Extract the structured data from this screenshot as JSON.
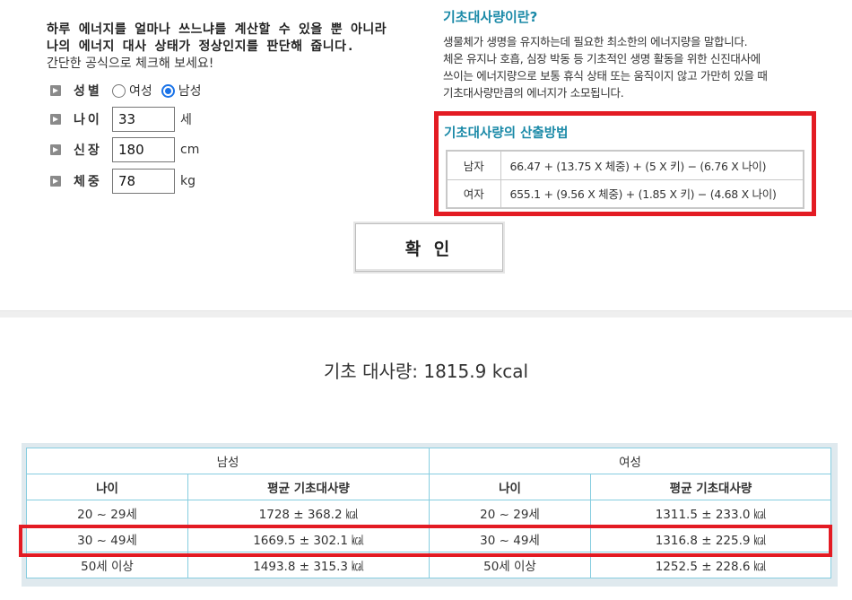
{
  "intro": {
    "line1": "하루 에너지를 얼마나 쓰느냐를 계산할 수 있을 뿐 아니라",
    "line2": "나의 에너지 대사 상태가 정상인지를 판단해 줍니다.",
    "line3": "간단한 공식으로 체크해 보세요!"
  },
  "form": {
    "gender_label": "성별",
    "female": "여성",
    "male": "남성",
    "selected": "남성",
    "age_label": "나이",
    "age_value": "33",
    "age_unit": "세",
    "height_label": "신장",
    "height_value": "180",
    "height_unit": "cm",
    "weight_label": "체중",
    "weight_value": "78",
    "weight_unit": "kg"
  },
  "info": {
    "title": "기초대사량이란?",
    "lines": [
      "생물체가 생명을 유지하는데 필요한 최소한의 에너지량을 말합니다.",
      "체온 유지나 호흡, 심장 박동 등 기초적인 생명 활동을 위한 신진대사에",
      "쓰이는 에너지량으로 보통 휴식 상태 또는 움직이지 않고 가만히 있을 때",
      "기초대사량만큼의 에너지가 소모됩니다."
    ]
  },
  "calc": {
    "title": "기초대사량의 산출방법",
    "rows": [
      {
        "sex": "남자",
        "formula": "66.47 + (13.75 X 체중) + (5 X 키) − (6.76 X 나이)"
      },
      {
        "sex": "여자",
        "formula": "655.1 + (9.56 X 체중) + (1.85 X 키) − (4.68 X 나이)"
      }
    ]
  },
  "button": {
    "label": "확 인"
  },
  "result": {
    "text": "기초 대사량: 1815.9 kcal"
  },
  "table": {
    "male_header": "남성",
    "female_header": "여성",
    "age_header": "나이",
    "avg_header": "평균 기초대사량",
    "rows": [
      {
        "m_age": "20 ~ 29세",
        "m_val": "1728 ± 368.2 ㎉",
        "f_age": "20 ~ 29세",
        "f_val": "1311.5 ± 233.0 ㎉"
      },
      {
        "m_age": "30 ~ 49세",
        "m_val": "1669.5 ± 302.1 ㎉",
        "f_age": "30 ~ 49세",
        "f_val": "1316.8 ± 225.9 ㎉"
      },
      {
        "m_age": "50세 이상",
        "m_val": "1493.8 ± 315.3 ㎉",
        "f_age": "50세 이상",
        "f_val": "1252.5 ± 228.6 ㎉"
      }
    ]
  },
  "colors": {
    "accent": "#1b8aa8",
    "highlight": "#e31b23",
    "table_border": "#86cde0"
  }
}
